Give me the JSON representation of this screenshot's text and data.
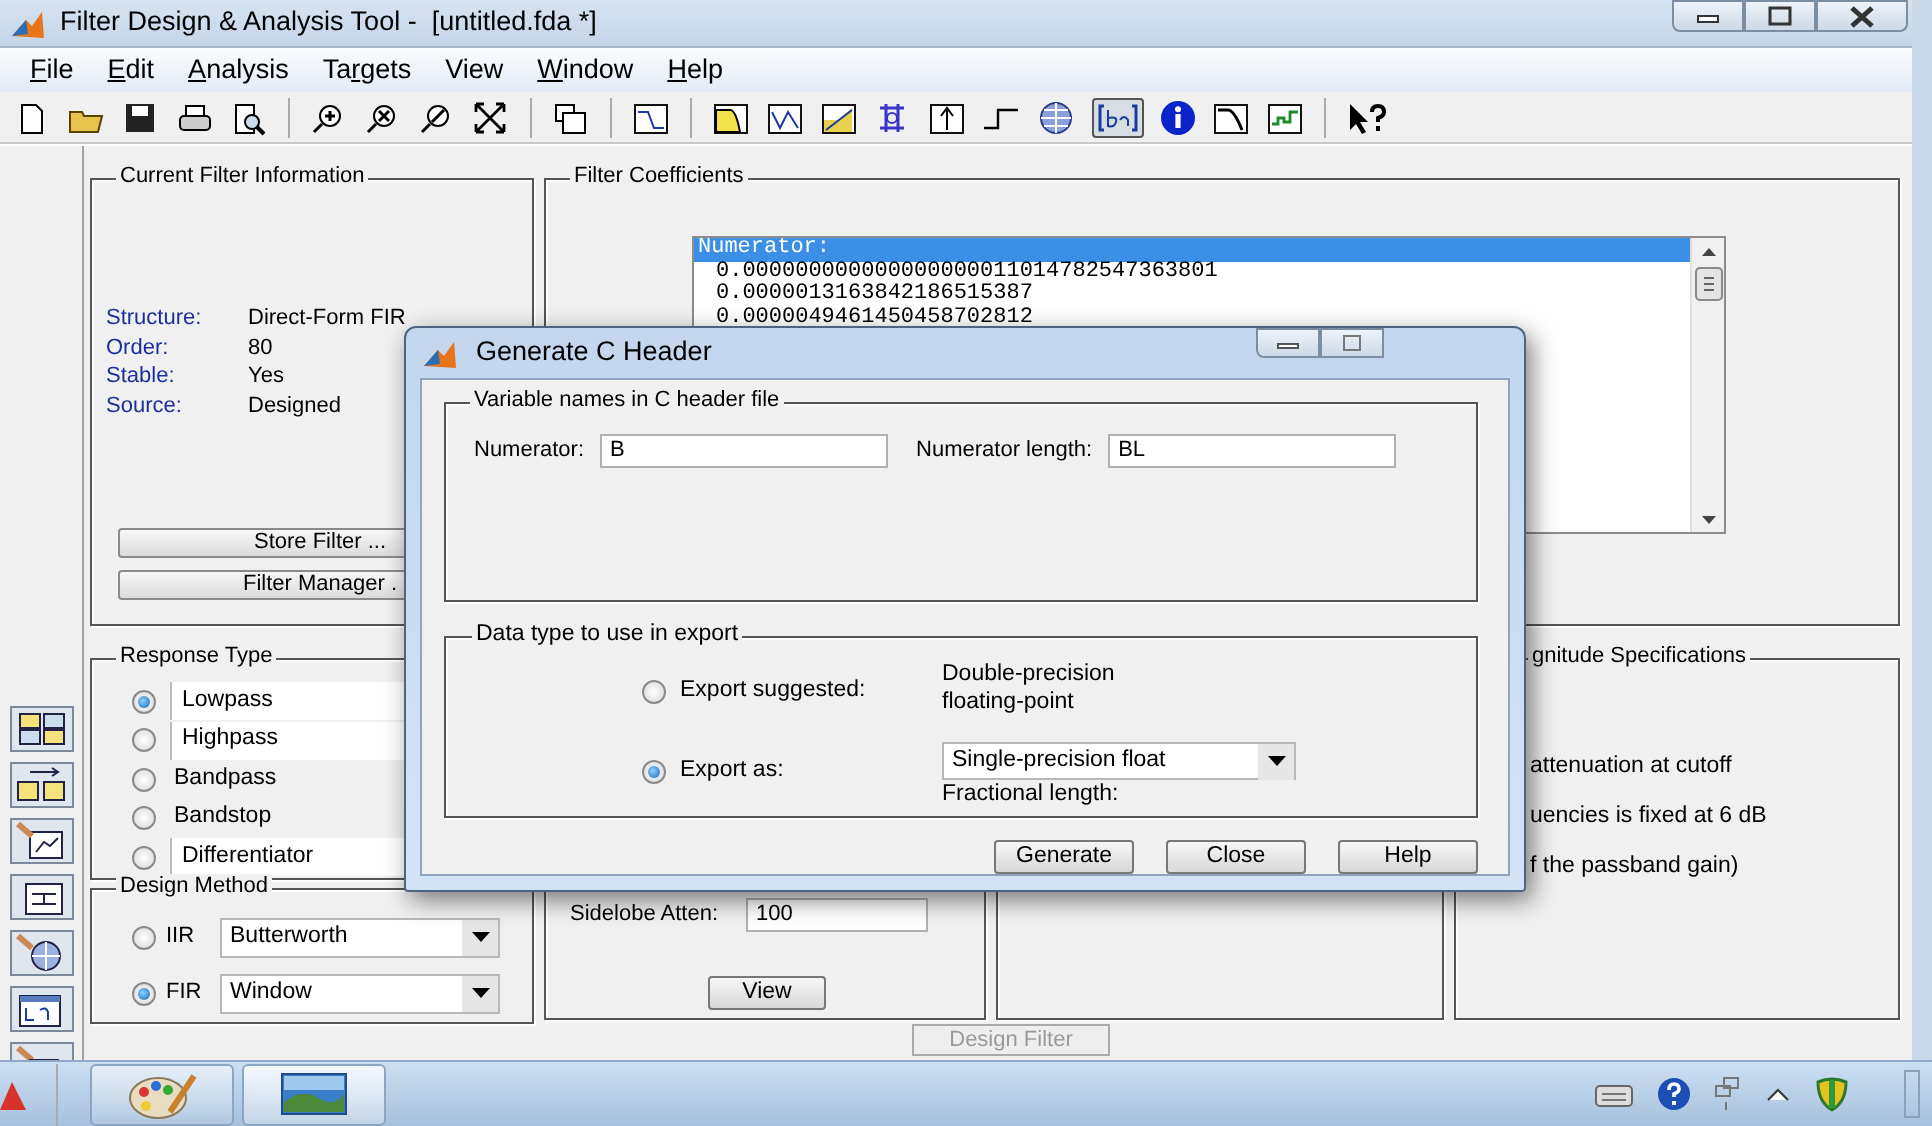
{
  "window": {
    "title": "Filter Design & Analysis Tool -  [untitled.fda *]"
  },
  "menu": [
    {
      "mnemonic": "F",
      "rest": "ile"
    },
    {
      "mnemonic": "E",
      "rest": "dit"
    },
    {
      "mnemonic": "A",
      "rest": "nalysis"
    },
    {
      "before": "Ta",
      "mnemonic": "r",
      "rest": "gets"
    },
    {
      "rest": "View"
    },
    {
      "mnemonic": "W",
      "rest": "indow"
    },
    {
      "mnemonic": "H",
      "rest": "elp"
    }
  ],
  "toolbar": {
    "coefficients_pressed": true
  },
  "current_filter_info": {
    "title": "Current Filter Information",
    "fields": [
      {
        "label": "Structure:",
        "value": "Direct-Form FIR"
      },
      {
        "label": "Order:",
        "value": "80"
      },
      {
        "label": "Stable:",
        "value": "Yes"
      },
      {
        "label": "Source:",
        "value": "Designed"
      }
    ],
    "buttons": [
      "Store Filter ...",
      "Filter Manager ."
    ]
  },
  "filter_coefficients": {
    "title": "Filter Coefficients",
    "lines": [
      {
        "text": "Numerator:",
        "selected": true
      },
      {
        "text": "0.000000000000000000011014782547363801",
        "selected": false
      },
      {
        "text": "0.0000013163842186515387",
        "selected": false
      },
      {
        "text": "0.0000049461450458702812",
        "selected": false
      }
    ]
  },
  "response_type": {
    "title": "Response Type",
    "options": [
      {
        "label": "Lowpass",
        "kind": "popup",
        "selected": true
      },
      {
        "label": "Highpass",
        "kind": "popup",
        "selected": false
      },
      {
        "label": "Bandpass",
        "kind": "plain",
        "selected": false
      },
      {
        "label": "Bandstop",
        "kind": "plain",
        "selected": false
      },
      {
        "label": "Differentiator",
        "kind": "popup",
        "selected": false
      }
    ]
  },
  "design_method": {
    "title": "Design Method",
    "options": [
      {
        "label": "IIR",
        "value": "Butterworth",
        "selected": false
      },
      {
        "label": "FIR",
        "value": "Window",
        "selected": true
      }
    ]
  },
  "options_panel": {
    "label": "Sidelobe Atten:",
    "value": "100",
    "button": "View"
  },
  "magnitude_specifications": {
    "title": "gnitude Specifications",
    "lines": [
      "attenuation at cutoff",
      "uencies is fixed at 6 dB",
      "f the passband gain)"
    ]
  },
  "design_filter_button": {
    "label": "Design Filter",
    "disabled": true
  },
  "dialog": {
    "title": "Generate C Header",
    "names_group": {
      "title": "Variable names in C header file",
      "fields": [
        {
          "label": "Numerator:",
          "value": "B"
        },
        {
          "label": "Numerator length:",
          "value": "BL"
        }
      ]
    },
    "type_group": {
      "title": "Data type to use in export",
      "options": [
        {
          "label": "Export suggested:",
          "selected": false,
          "kind": "text",
          "text": "Double-precision floating-point"
        },
        {
          "label": "Export as:",
          "selected": true,
          "kind": "select",
          "value": "Single-precision float",
          "note": "Fractional length:"
        }
      ]
    },
    "buttons": [
      "Generate",
      "Close",
      "Help"
    ]
  }
}
